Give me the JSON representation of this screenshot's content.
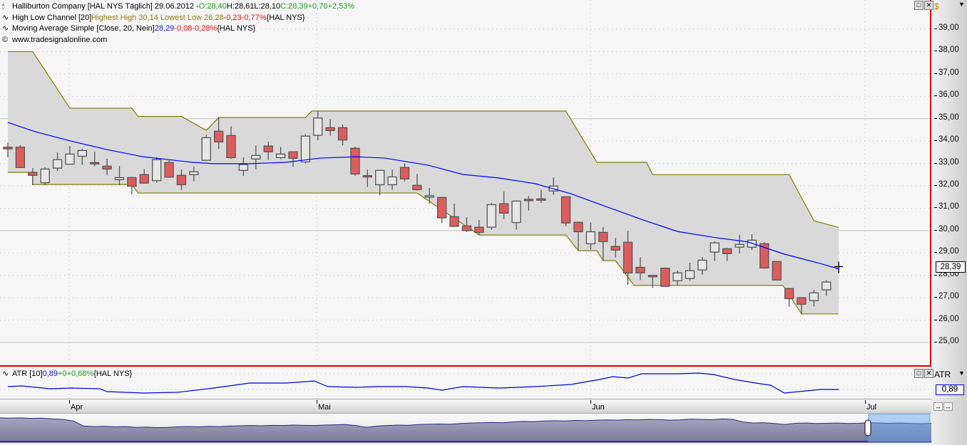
{
  "legend": {
    "symbol_line": {
      "name": "Halliburton Company [HAL NYS  Täglich] 29.06.2012 -",
      "open": "O:28,40",
      "high": "H:28,61",
      "low": "L:28,10",
      "close": "C:28,39",
      "change": "+0,70",
      "change_pct": "+2,53%"
    },
    "channel_line": {
      "name": "High Low Channel [20]",
      "values": "Highest High 30,14 Lowest Low 26,28",
      "change": "-0,23",
      "change_pct": "-0,77%",
      "source": "{HAL NYS}"
    },
    "ma_line": {
      "name": "Moving Average Simple [Close, 20, Nein]",
      "value": "28,29",
      "change": "-0,08",
      "change_pct": "-0,28%",
      "source": "{HAL NYS}"
    },
    "watermark": "www.tradesignalonline.com"
  },
  "price_axis": {
    "currency": "$",
    "current_label": "28,39",
    "ticks": [
      "39,00",
      "38,00",
      "37,00",
      "36,00",
      "35,00",
      "34,00",
      "33,00",
      "32,00",
      "31,00",
      "30,00",
      "29,00",
      "28,00",
      "27,00",
      "26,00",
      "25,00"
    ]
  },
  "atr": {
    "legend_name": "ATR [10]",
    "value": "0,89",
    "change": "+0",
    "change_pct": "+0,68%",
    "source": "{HAL NYS}",
    "axis_label": "ATR",
    "current_label": "0,89"
  },
  "date_axis": {
    "labels": [
      "Apr",
      "Mai",
      "Jun",
      "Jul"
    ]
  },
  "colors": {
    "up_fill": "#e6e6e6",
    "down_fill": "#e05c5c",
    "channel": "#808000",
    "ma": "#0000ff",
    "atr": "#0000e0",
    "selected_border": "#e00000"
  },
  "chart_data": {
    "type": "candlestick",
    "title": "Halliburton Company [HAL NYS Täglich]",
    "ylim": [
      24,
      40
    ],
    "x_month_labels": {
      "Apr": 5,
      "Mai": 25,
      "Jun": 47,
      "Jul": 69
    },
    "ohlc": [
      [
        33.73,
        33.92,
        33.28,
        33.65
      ],
      [
        33.73,
        33.81,
        32.82,
        32.82
      ],
      [
        32.6,
        32.79,
        32.03,
        32.47
      ],
      [
        32.14,
        32.83,
        32.03,
        32.75
      ],
      [
        32.79,
        33.49,
        32.67,
        33.17
      ],
      [
        32.97,
        33.78,
        32.94,
        33.42
      ],
      [
        33.32,
        33.65,
        32.94,
        33.58
      ],
      [
        33.04,
        33.53,
        32.88,
        32.98
      ],
      [
        32.88,
        33.21,
        32.48,
        32.75
      ],
      [
        32.28,
        32.89,
        32.03,
        32.37
      ],
      [
        32.37,
        32.4,
        31.63,
        31.99
      ],
      [
        32.5,
        32.75,
        32.12,
        32.12
      ],
      [
        32.23,
        33.27,
        32.14,
        33.17
      ],
      [
        33.04,
        33.14,
        32.37,
        32.39
      ],
      [
        32.47,
        32.73,
        31.82,
        32.05
      ],
      [
        32.5,
        32.85,
        32.2,
        32.63
      ],
      [
        33.14,
        34.28,
        33.14,
        34.15
      ],
      [
        34.44,
        35.08,
        33.65,
        33.96
      ],
      [
        34.25,
        34.66,
        33.2,
        33.26
      ],
      [
        32.69,
        33.27,
        32.44,
        32.95
      ],
      [
        33.2,
        33.81,
        32.74,
        33.36
      ],
      [
        33.78,
        33.97,
        33.16,
        33.52
      ],
      [
        33.26,
        33.74,
        33.2,
        33.42
      ],
      [
        33.52,
        33.52,
        32.85,
        33.23
      ],
      [
        33.07,
        34.3,
        33.0,
        34.22
      ],
      [
        34.26,
        35.34,
        34.04,
        35.03
      ],
      [
        34.6,
        34.98,
        34.24,
        34.47
      ],
      [
        34.6,
        34.74,
        33.81,
        34.05
      ],
      [
        33.68,
        33.75,
        32.46,
        32.53
      ],
      [
        32.46,
        32.73,
        31.95,
        32.4
      ],
      [
        32.05,
        32.69,
        31.58,
        32.69
      ],
      [
        32.05,
        32.73,
        31.82,
        32.4
      ],
      [
        32.82,
        32.99,
        32.2,
        32.31
      ],
      [
        32.02,
        32.53,
        31.79,
        31.83
      ],
      [
        31.56,
        31.9,
        31.2,
        31.56
      ],
      [
        31.48,
        31.51,
        30.34,
        30.57
      ],
      [
        30.62,
        31.2,
        30.19,
        30.19
      ],
      [
        30.21,
        30.6,
        29.94,
        30.0
      ],
      [
        30.15,
        30.47,
        29.8,
        29.92
      ],
      [
        30.15,
        31.24,
        30.04,
        31.16
      ],
      [
        31.2,
        31.75,
        30.51,
        30.78
      ],
      [
        30.36,
        31.35,
        30.04,
        31.32
      ],
      [
        31.4,
        31.55,
        30.9,
        31.38
      ],
      [
        31.42,
        31.81,
        31.24,
        31.36
      ],
      [
        31.77,
        32.38,
        31.6,
        31.99
      ],
      [
        31.51,
        31.51,
        30.2,
        30.34
      ],
      [
        30.37,
        30.4,
        29.1,
        29.95
      ],
      [
        29.41,
        30.37,
        29.15,
        29.95
      ],
      [
        29.92,
        30.15,
        28.64,
        29.51
      ],
      [
        29.29,
        29.67,
        28.8,
        29.13
      ],
      [
        29.48,
        29.99,
        27.58,
        28.11
      ],
      [
        28.36,
        28.81,
        27.79,
        28.11
      ],
      [
        28.0,
        28.01,
        27.44,
        27.97
      ],
      [
        28.32,
        28.36,
        27.51,
        27.51
      ],
      [
        27.76,
        28.21,
        27.53,
        28.11
      ],
      [
        27.86,
        28.56,
        27.76,
        28.21
      ],
      [
        28.24,
        28.82,
        28.03,
        28.68
      ],
      [
        29.04,
        29.52,
        28.64,
        29.45
      ],
      [
        29.19,
        29.22,
        28.64,
        28.97
      ],
      [
        29.26,
        29.81,
        28.97,
        29.38
      ],
      [
        29.26,
        29.84,
        29.13,
        29.57
      ],
      [
        29.41,
        29.48,
        28.3,
        28.33
      ],
      [
        28.62,
        28.62,
        27.79,
        27.79
      ],
      [
        27.41,
        27.44,
        26.6,
        26.96
      ],
      [
        27.0,
        27.03,
        26.26,
        26.71
      ],
      [
        26.87,
        27.35,
        26.61,
        27.22
      ],
      [
        27.35,
        27.79,
        27.08,
        27.7
      ],
      [
        28.4,
        28.61,
        28.1,
        28.39
      ]
    ],
    "channel_upper": [
      [
        0,
        38.0
      ],
      [
        2,
        38.0
      ],
      [
        5,
        35.47
      ],
      [
        10,
        35.47
      ],
      [
        10.5,
        35.1
      ],
      [
        14,
        35.1
      ],
      [
        16,
        34.48
      ],
      [
        17,
        35.05
      ],
      [
        24,
        35.05
      ],
      [
        24.5,
        35.34
      ],
      [
        45,
        35.34
      ],
      [
        47.5,
        33.05
      ],
      [
        51.5,
        33.05
      ],
      [
        52,
        32.5
      ],
      [
        63,
        32.5
      ],
      [
        65,
        30.44
      ],
      [
        67,
        30.14
      ]
    ],
    "channel_lower": [
      [
        0,
        32.6
      ],
      [
        2,
        32.6
      ],
      [
        2,
        32.06
      ],
      [
        10,
        32.06
      ],
      [
        10.5,
        31.68
      ],
      [
        33,
        31.68
      ],
      [
        38,
        29.8
      ],
      [
        45,
        29.8
      ],
      [
        46,
        29.1
      ],
      [
        47.5,
        29.1
      ],
      [
        48,
        28.66
      ],
      [
        49,
        28.66
      ],
      [
        50.5,
        27.55
      ],
      [
        62.5,
        27.55
      ],
      [
        64,
        26.28
      ],
      [
        67,
        26.28
      ]
    ],
    "ma20": [
      [
        0,
        34.83
      ],
      [
        2.2,
        34.42
      ],
      [
        5.1,
        34.0
      ],
      [
        8,
        33.62
      ],
      [
        10.9,
        33.3
      ],
      [
        14.9,
        33.05
      ],
      [
        16.6,
        32.99
      ],
      [
        19.5,
        32.99
      ],
      [
        22.4,
        33.05
      ],
      [
        25.2,
        33.24
      ],
      [
        28.1,
        33.3
      ],
      [
        30.4,
        33.24
      ],
      [
        33.9,
        32.92
      ],
      [
        36.7,
        32.51
      ],
      [
        39.6,
        32.35
      ],
      [
        42.5,
        32.1
      ],
      [
        45.4,
        31.65
      ],
      [
        48.2,
        31.08
      ],
      [
        51.1,
        30.5
      ],
      [
        54,
        29.96
      ],
      [
        56.9,
        29.7
      ],
      [
        59.7,
        29.49
      ],
      [
        62.6,
        28.95
      ],
      [
        65.5,
        28.53
      ],
      [
        67,
        28.29
      ]
    ],
    "atr10": [
      [
        0,
        0.97
      ],
      [
        1.1,
        0.99
      ],
      [
        3.4,
        0.91
      ],
      [
        5.1,
        0.93
      ],
      [
        7.4,
        0.91
      ],
      [
        8,
        0.83
      ],
      [
        10.9,
        0.79
      ],
      [
        13.7,
        0.81
      ],
      [
        16.6,
        0.93
      ],
      [
        19.5,
        1.07
      ],
      [
        22.4,
        1.07
      ],
      [
        24.1,
        1.11
      ],
      [
        24.7,
        1.13
      ],
      [
        25.8,
        0.97
      ],
      [
        28.1,
        0.95
      ],
      [
        29.8,
        0.97
      ],
      [
        32.1,
        0.97
      ],
      [
        33.9,
        0.93
      ],
      [
        35,
        0.87
      ],
      [
        36.7,
        0.97
      ],
      [
        39.6,
        0.93
      ],
      [
        42.5,
        0.97
      ],
      [
        45.4,
        1.03
      ],
      [
        47.7,
        1.17
      ],
      [
        48.8,
        1.25
      ],
      [
        50,
        1.21
      ],
      [
        51.1,
        1.33
      ],
      [
        54,
        1.33
      ],
      [
        55.7,
        1.35
      ],
      [
        56.9,
        1.31
      ],
      [
        58.6,
        1.17
      ],
      [
        60.3,
        1.07
      ],
      [
        61.5,
        1.01
      ],
      [
        62.6,
        0.79
      ],
      [
        63.8,
        0.83
      ],
      [
        65.5,
        0.89
      ],
      [
        67,
        0.89
      ]
    ],
    "navigator_series": [
      92,
      91,
      92,
      90,
      91,
      88,
      86,
      80,
      60,
      58,
      59,
      57,
      58,
      55,
      56,
      54,
      55,
      57,
      58,
      57,
      59,
      58,
      60,
      61,
      62,
      61,
      63,
      62,
      64,
      63,
      62,
      64,
      65,
      66,
      62,
      55,
      60,
      62,
      64,
      63,
      66,
      67,
      68,
      67,
      70,
      72,
      73,
      74,
      73,
      76,
      78,
      77,
      80,
      81,
      80,
      82,
      81,
      83,
      84,
      83,
      85,
      84,
      86,
      85,
      83,
      84,
      87,
      86,
      85,
      88,
      86,
      76,
      72,
      73,
      70,
      66,
      71,
      72,
      70,
      71,
      72,
      70,
      71,
      73,
      72,
      71,
      72,
      70,
      69,
      71
    ]
  }
}
